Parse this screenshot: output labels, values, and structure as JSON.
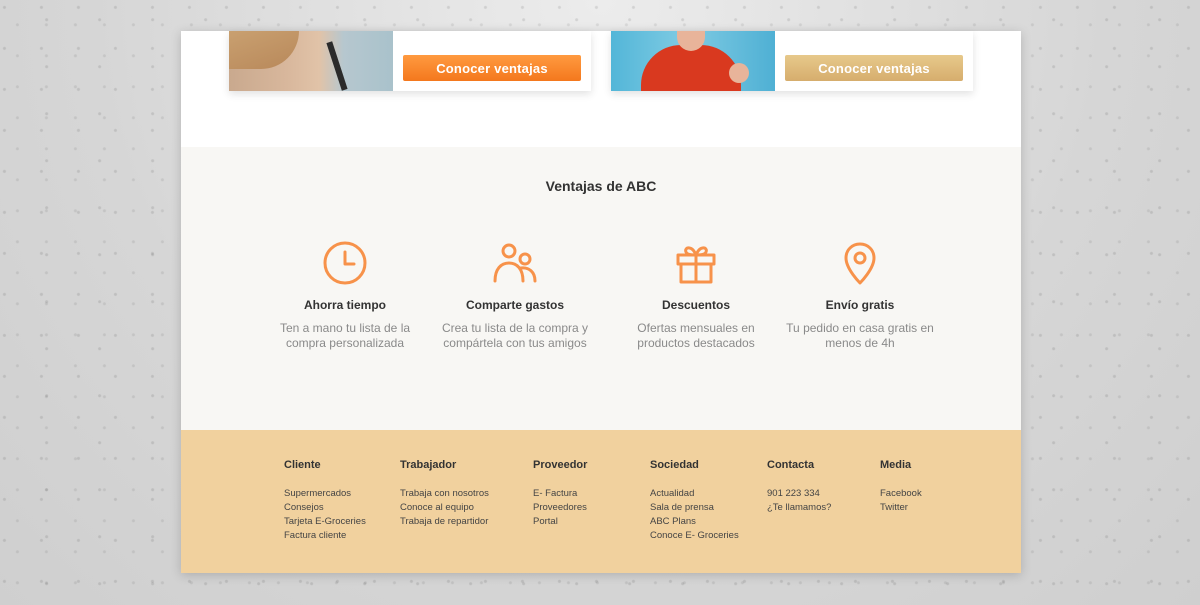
{
  "cards": [
    {
      "button_label": "Conocer ventajas"
    },
    {
      "button_label": "Conocer ventajas"
    }
  ],
  "benefits": {
    "title": "Ventajas de ABC",
    "items": [
      {
        "icon": "clock-icon",
        "title": "Ahorra tiempo",
        "text": "Ten a mano tu lista de la compra personalizada"
      },
      {
        "icon": "users-icon",
        "title": "Comparte gastos",
        "text": "Crea tu lista de la compra y compártela con tus amigos"
      },
      {
        "icon": "gift-icon",
        "title": "Descuentos",
        "text": "Ofertas mensuales en productos destacados"
      },
      {
        "icon": "location-pin-icon",
        "title": "Envío gratis",
        "text": "Tu pedido en casa gratis en menos de 4h"
      }
    ]
  },
  "footer": {
    "columns": [
      {
        "title": "Cliente",
        "links": [
          "Supermercados",
          "Consejos",
          "Tarjeta E-Groceries",
          "Factura cliente"
        ]
      },
      {
        "title": "Trabajador",
        "links": [
          "Trabaja con nosotros",
          "Conoce al equipo",
          "Trabaja de repartidor"
        ]
      },
      {
        "title": "Proveedor",
        "links": [
          "E- Factura",
          "Proveedores",
          "Portal"
        ]
      },
      {
        "title": "Sociedad",
        "links": [
          "Actualidad",
          "Sala de prensa",
          "ABC Plans",
          "Conoce E- Groceries"
        ]
      },
      {
        "title": "Contacta",
        "links": [
          "901 223 334",
          "¿Te llamamos?"
        ]
      },
      {
        "title": "Media",
        "links": [
          "Facebook",
          "Twitter"
        ]
      }
    ]
  },
  "colors": {
    "accent_orange": "#f4781d",
    "accent_gold": "#d6ad6d",
    "icon_orange": "#f7924a",
    "footer_bg": "#f1d19e",
    "benefits_bg": "#f8f7f4"
  }
}
